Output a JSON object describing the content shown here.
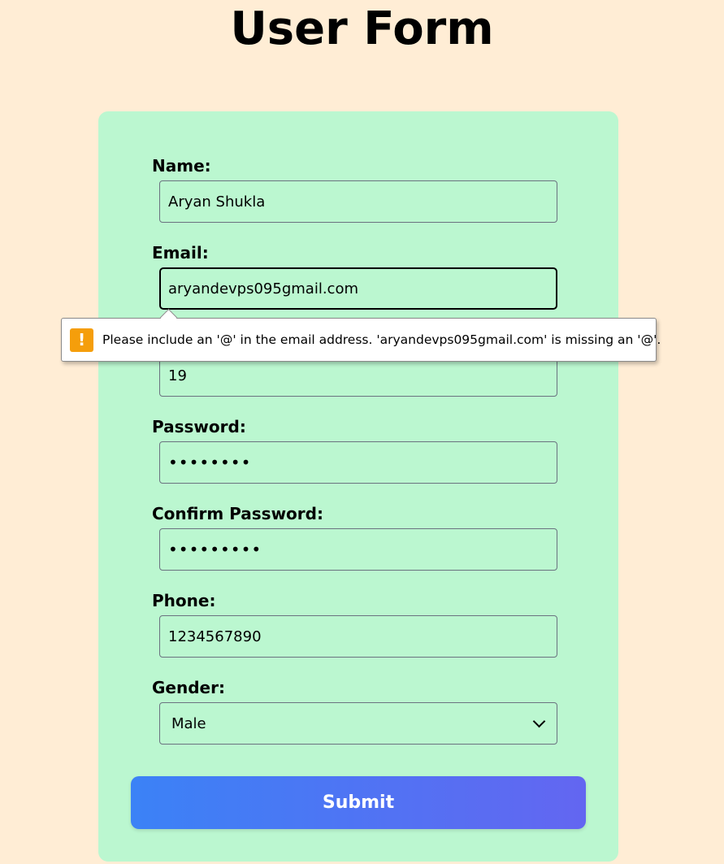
{
  "page": {
    "title": "User Form"
  },
  "form": {
    "name": {
      "label": "Name:",
      "value": "Aryan Shukla"
    },
    "email": {
      "label": "Email:",
      "value": "aryandevps095gmail.com"
    },
    "age": {
      "value": "19"
    },
    "password": {
      "label": "Password:",
      "value": "••••••••"
    },
    "confirm_password": {
      "label": "Confirm Password:",
      "value": "•••••••••"
    },
    "phone": {
      "label": "Phone:",
      "value": "1234567890"
    },
    "gender": {
      "label": "Gender:",
      "selected": "Male"
    },
    "submit_label": "Submit"
  },
  "validation": {
    "message": "Please include an '@' in the email address. 'aryandevps095gmail.com' is missing an '@'.",
    "icon": "warning-icon",
    "icon_glyph": "!",
    "icon_color": "#f59e0b"
  },
  "colors": {
    "background": "#ffedd5",
    "card": "#bbf7d0",
    "submit_gradient_start": "#3b82f6",
    "submit_gradient_end": "#6366f1"
  }
}
